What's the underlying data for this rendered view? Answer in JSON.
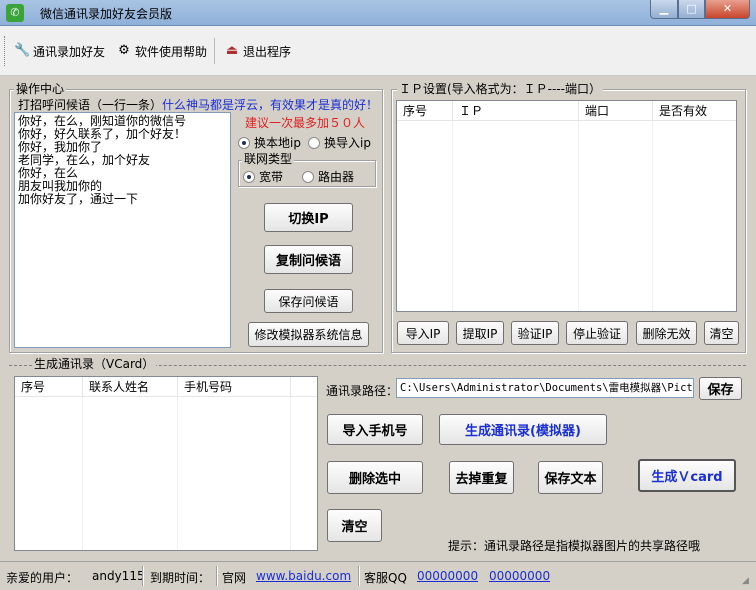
{
  "window": {
    "title": "微信通讯录加好友会员版",
    "app_icon": "wechat-icon"
  },
  "toolbar": {
    "items": [
      {
        "label": "通讯录加好友",
        "icon": "tools-icon"
      },
      {
        "label": "软件使用帮助",
        "icon": "gear-icon"
      },
      {
        "label": "退出程序",
        "icon": "exit-icon"
      }
    ]
  },
  "operation": {
    "legend": "操作中心",
    "greeting_label": "打招呼问候语（一行一条）",
    "greeting_tip": "什么神马都是浮云，有效果才是真的好！",
    "greetings_text": "你好，在么，刚知道你的微信号\n你好，好久联系了，加个好友！\n你好，我加你了\n老同学，在么，加个好友\n你好，在么\n朋友叫我加你的\n加你好友了，通过一下",
    "limit_tip": "建议一次最多加５０人",
    "ip_mode": {
      "local_label": "换本地ip",
      "import_label": "换导入ip",
      "selected": "local"
    },
    "net_type": {
      "legend": "联网类型",
      "broadband_label": "宽带",
      "router_label": "路由器",
      "selected": "broadband"
    },
    "buttons": {
      "switch_ip": "切换IP",
      "copy_greeting": "复制问候语",
      "save_greeting": "保存问候语",
      "modify_info": "修改模拟器系统信息"
    }
  },
  "ip": {
    "legend": "ＩＰ设置(导入格式为：ＩＰ----端口）",
    "columns": [
      "序号",
      "ＩＰ",
      "端口",
      "是否有效"
    ],
    "buttons": {
      "import": "导入IP",
      "extract": "提取IP",
      "verify": "验证IP",
      "stop": "停止验证",
      "delete_invalid": "删除无效",
      "clear": "清空"
    }
  },
  "vcard": {
    "legend": "生成通讯录（VCard）",
    "columns": [
      "序号",
      "联系人姓名",
      "手机号码"
    ],
    "path_label": "通讯录路径：",
    "path_value": "C:\\Users\\Administrator\\Documents\\雷电模拟器\\Pictu",
    "buttons": {
      "save": "保存",
      "import_phone": "导入手机号",
      "generate_emulator": "生成通讯录(模拟器)",
      "delete_selected": "删除选中",
      "dedupe": "去掉重复",
      "save_text": "保存文本",
      "generate_vcard": "生成Ｖcard",
      "clear": "清空"
    },
    "hint": "提示：通讯录路径是指模拟器图片的共享路径哦"
  },
  "status": {
    "user_label": "亲爱的用户：",
    "user_name": "andy115",
    "expire_label": "到期时间：",
    "site_label": "官网",
    "site_link": "www.baidu.com",
    "qq_label": "客服QQ",
    "qq1": "00000000",
    "qq2": "00000000"
  }
}
